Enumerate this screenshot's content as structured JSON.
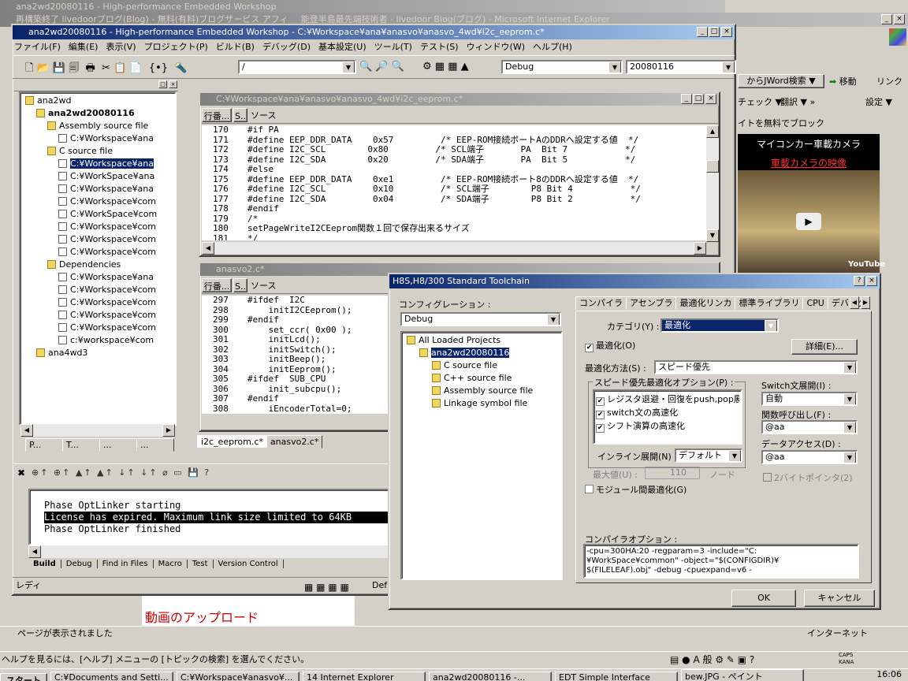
{
  "bg_windows": {
    "t1": "再構築終了 livedoorブログ(Blog) - 無料(有料)ブログサービス アフィ",
    "t2": "能登半島最先端技術者 - livedoor Blog(ブログ) - Microsoft Internet Explorer",
    "t0": "ana2wd20080116 - High-performance Embedded Workshop"
  },
  "ie": {
    "search_btn": "からJWord検索",
    "move": "移動",
    "link": "リンク",
    "check": "チェック",
    "translate": "翻訳",
    "settings": "設定",
    "block": "イトを無料でブロック",
    "video_title": "マイコンカー車載カメラ",
    "video_link": "車載カメラの映像",
    "upload": "動画のアップロード",
    "status": "ページが表示されました",
    "internet": "インターネット",
    "youtube": "YouTube"
  },
  "hew": {
    "title": "ana2wd20080116 - High-performance Embedded Workshop - C:¥Workspace¥ana¥anasvo¥anasvo_4wd¥i2c_eeprom.c*",
    "menu": [
      "ファイル(F)",
      "編集(E)",
      "表示(V)",
      "プロジェクト(P)",
      "ビルド(B)",
      "デバッグ(D)",
      "基本設定(U)",
      "ツール(T)",
      "テスト(S)",
      "ウィンドウ(W)",
      "ヘルプ(H)"
    ],
    "toolbar": {
      "find": "/",
      "config": "Debug",
      "session": "20080116"
    },
    "tree": [
      "ana2wd",
      "ana2wd20080116",
      "Assembly source file",
      "C:¥Workspace¥ana",
      "C source file",
      "C:¥Workspace¥ana",
      "C:¥WorkSpace¥ana",
      "C:¥Workspace¥ana",
      "C:¥Workspace¥com",
      "C:¥WorkSpace¥com",
      "C:¥Workspace¥com",
      "C:¥Workspace¥com",
      "C:¥Workspace¥com",
      "Dependencies",
      "C:¥Workspace¥ana",
      "C:¥Workspace¥com",
      "C:¥Workspace¥com",
      "C:¥Workspace¥com",
      "C:¥Workspace¥com",
      "c:¥workspace¥com",
      "ana4wd3"
    ],
    "tree_tabs": [
      "P...",
      "T...",
      "...",
      "..."
    ],
    "editor1": {
      "title": "C:¥Workspace¥ana¥anasvo¥anasvo_4wd¥i2c_eeprom.c*",
      "h1": "行番...",
      "h2": "S..",
      "h3": "ソース",
      "lines": [
        [
          "170",
          "#if PA"
        ],
        [
          "171",
          "#define EEP_DDR_DATA    0x57         /* EEP-ROM接続ポートAのDDRへ設定する値  */"
        ],
        [
          "172",
          "#define I2C_SCL        0x80         /* SCL端子       PA  Bit 7           */"
        ],
        [
          "173",
          "#define I2C_SDA        0x20         /* SDA端子       PA  Bit 5           */"
        ],
        [
          "174",
          "#else"
        ],
        [
          "175",
          "#define EEP_DDR_DATA    0xe1         /* EEP-ROM接続ポート8のDDRへ設定する値  */"
        ],
        [
          "176",
          "#define I2C_SCL         0x10         /* SCL端子        P8 Bit 4           */"
        ],
        [
          "177",
          "#define I2C_SDA         0x04         /* SDA端子        P8 Bit 2           */"
        ],
        [
          "178",
          "#endif"
        ],
        [
          "179",
          "/*"
        ],
        [
          "180",
          "setPageWriteI2CEeprom関数１回で保存出来るサイズ"
        ],
        [
          "181",
          "*/"
        ]
      ]
    },
    "editor2": {
      "title": "anasvo2.c*",
      "h1": "行番...",
      "h2": "S..",
      "h3": "ソース",
      "lines": [
        [
          "297",
          "#ifdef  I2C"
        ],
        [
          "298",
          "    initI2CEeprom();"
        ],
        [
          "299",
          "#endif"
        ],
        [
          "300",
          "    set_ccr( 0x00 );"
        ],
        [
          "301",
          "    initLcd();"
        ],
        [
          "302",
          "    initSwitch();"
        ],
        [
          "303",
          "    initBeep();"
        ],
        [
          "304",
          "    initEeprom();"
        ],
        [
          "305",
          "#ifdef  SUB_CPU"
        ],
        [
          "306",
          "    init_subcpu();"
        ],
        [
          "307",
          "#endif"
        ],
        [
          "308",
          "    iEncoderTotal=0;"
        ]
      ]
    },
    "doc_tabs": [
      "i2c_eeprom.c*",
      "anasvo2.c*"
    ],
    "output": [
      "Phase OptLinker starting",
      "License has expired. Maximum link size limited to 64KB",
      "Phase OptLinker finished"
    ],
    "out_tabs": [
      "Build",
      "Debug",
      "Find in Files",
      "Macro",
      "Test",
      "Version Control"
    ],
    "status": "レディ",
    "status2": "Def"
  },
  "dialog": {
    "title": "H8S,H8/300 Standard Toolchain",
    "config_label": "コンフィグレーション :",
    "config": "Debug",
    "tree": [
      "All Loaded Projects",
      "ana2wd20080116",
      "C source file",
      "C++ source file",
      "Assembly source file",
      "Linkage symbol file"
    ],
    "tabs": [
      "コンパイラ",
      "アセンブラ",
      "最適化リンカ",
      "標準ライブラリ",
      "CPU",
      "デバッグ"
    ],
    "category_label": "カテゴリ(Y) :",
    "category": "最適化",
    "optimize": "最適化(O)",
    "detail": "詳細(E)...",
    "method_label": "最適化方法(S) :",
    "method": "スピード優先",
    "group": "スピード優先最適化オプション(P) :",
    "opts": [
      "レジスタ退避・回復をpush,pop展開",
      "switch文の高速化",
      "シフト演算の高速化"
    ],
    "switch_label": "Switch文展開(I) :",
    "switch": "自動",
    "call_label": "関数呼び出し(F) :",
    "call": "@aa",
    "data_label": "データアクセス(D) :",
    "data": "@aa",
    "inline_label": "インライン展開(N) :",
    "inline": "デフォルト",
    "max_label": "最大値(U) :",
    "max": "110",
    "node": "ノード",
    "two_byte": "2バイトポインタ(2)",
    "module": "モジュール間最適化(G)",
    "options_label": "コンパイラオプション :",
    "options": "-cpu=300HA:20 -regparam=3 -include=\"C:¥WorkSpace¥common\" -object=\"$(CONFIGDIR)¥$(FILELEAF).obj\" -debug -cpuexpand=v6 -",
    "ok": "OK",
    "cancel": "キャンセル"
  },
  "help": "ヘルプを見るには、[ヘルプ] メニューの [トピックの検索] を選んでください。",
  "taskbar": {
    "start": "スタート",
    "items": [
      "C:¥Documents and Setti...",
      "C:¥Workspace¥anasvo¥...",
      "14 Internet Explorer",
      "ana2wd20080116 -...",
      "EDT Simple Interface",
      "bew.JPG - ペイント"
    ],
    "time": "16:06",
    "caps": "CAPS",
    "kana": "KANA",
    "a": "A",
    "han": "般"
  }
}
